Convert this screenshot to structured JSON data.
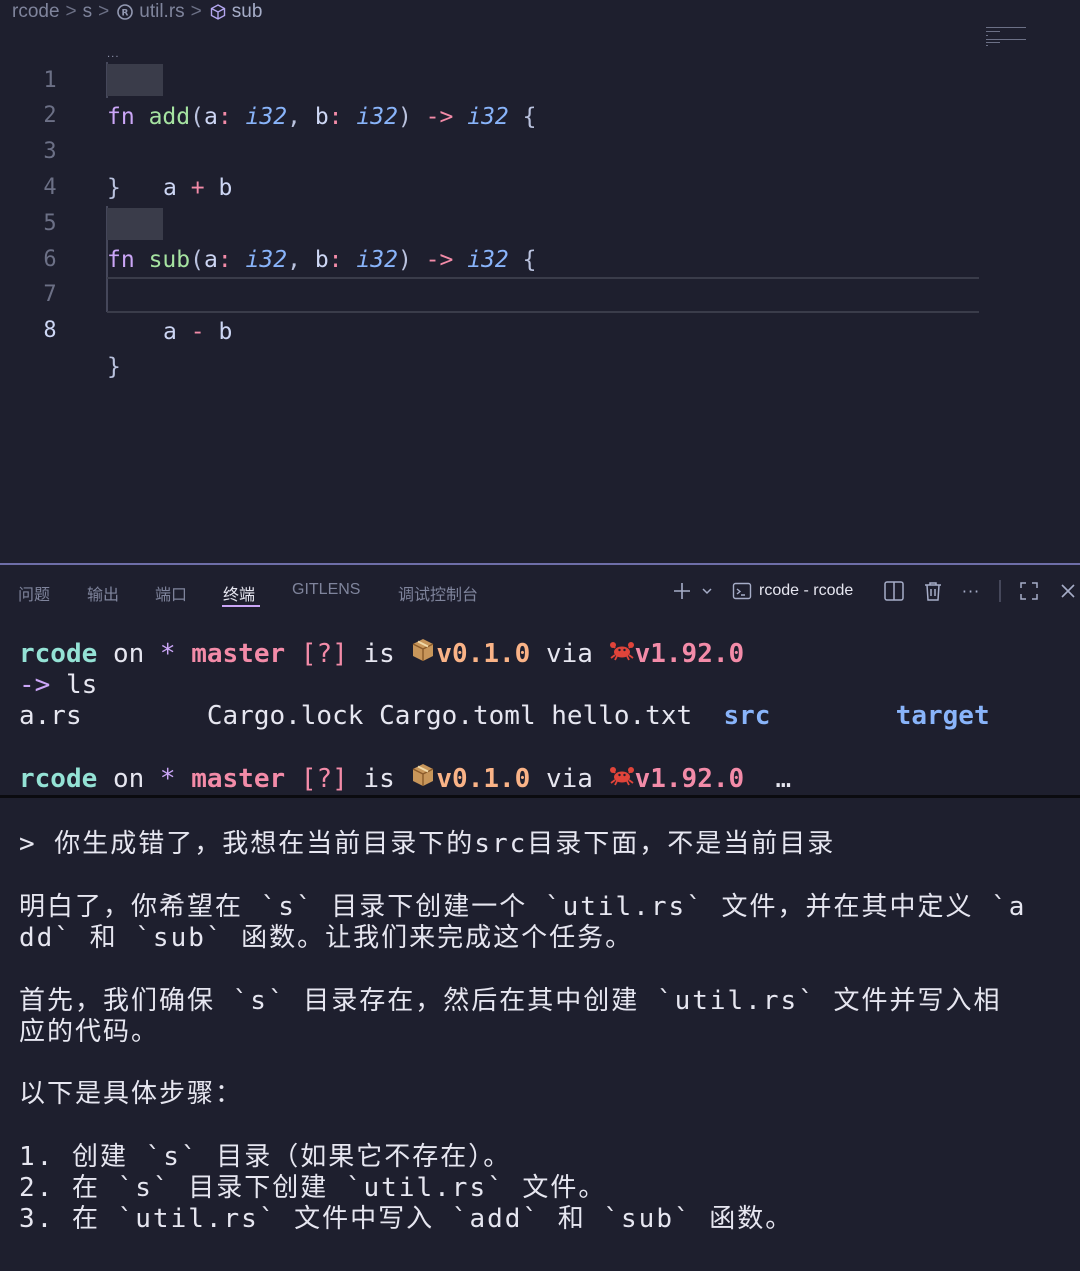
{
  "breadcrumb": {
    "items": [
      "rcode",
      "s",
      "util.rs",
      "sub"
    ],
    "separator": ">"
  },
  "editor": {
    "lines": [
      {
        "n": "1",
        "tokens": [
          "fn",
          "add",
          "(",
          "a",
          ":",
          "i32",
          ",",
          "b",
          ":",
          "i32",
          ")",
          "->",
          "i32",
          "{"
        ]
      },
      {
        "n": "2",
        "tokens": [
          "a",
          "+",
          "b"
        ]
      },
      {
        "n": "3",
        "tokens": [
          "}"
        ]
      },
      {
        "n": "4",
        "tokens": []
      },
      {
        "n": "5",
        "tokens": [
          "fn",
          "sub",
          "(",
          "a",
          ":",
          "i32",
          ",",
          "b",
          ":",
          "i32",
          ")",
          "->",
          "i32",
          "{"
        ]
      },
      {
        "n": "6",
        "tokens": [
          "a",
          "-",
          "b"
        ]
      },
      {
        "n": "7",
        "tokens": []
      },
      {
        "n": "8",
        "tokens": [
          "}"
        ]
      }
    ]
  },
  "panel": {
    "tabs": [
      "问题",
      "输出",
      "端口",
      "终端",
      "GITLENS",
      "调试控制台"
    ],
    "active_tab": "终端",
    "terminal_name": "rcode - rcode",
    "icons": [
      "plus-icon",
      "chevron-down-icon",
      "terminal-icon",
      "split-icon",
      "trash-icon",
      "more-icon",
      "maximize-icon",
      "close-icon"
    ]
  },
  "terminal": {
    "prompt": {
      "dir": "rcode",
      "on": "on",
      "star": "*",
      "branch": "master",
      "status": "[?]",
      "is": "is",
      "version": "v0.1.0",
      "via": "via",
      "rust": "v1.92.0"
    },
    "command_arrow": "->",
    "command": "ls",
    "files": [
      "a.rs",
      "Cargo.lock",
      "Cargo.toml",
      "hello.txt",
      "src",
      "target"
    ],
    "ellipsis": "…"
  },
  "chat": {
    "lines": [
      "> 你生成错了，我想在当前目录下的src目录下面，不是当前目录",
      "明白了，你希望在 `s` 目录下创建一个 `util.rs` 文件，并在其中定义 `a",
      "dd` 和 `sub` 函数。让我们来完成这个任务。",
      "首先，我们确保 `s` 目录存在，然后在其中创建 `util.rs` 文件并写入相",
      "应的代码。",
      "以下是具体步骤：",
      "1. 创建 `s` 目录（如果它不存在）。",
      "2. 在 `s` 目录下创建 `util.rs` 文件。",
      "3. 在 `util.rs` 文件中写入 `add` 和 `sub` 函数。"
    ]
  },
  "colors": {
    "background": "#1e1f2e",
    "keyword": "#cba6f7",
    "function": "#a6e3a1",
    "type": "#89b4fa",
    "operator": "#f38ba8",
    "dir": "#94e2d5",
    "version": "#fab387"
  }
}
